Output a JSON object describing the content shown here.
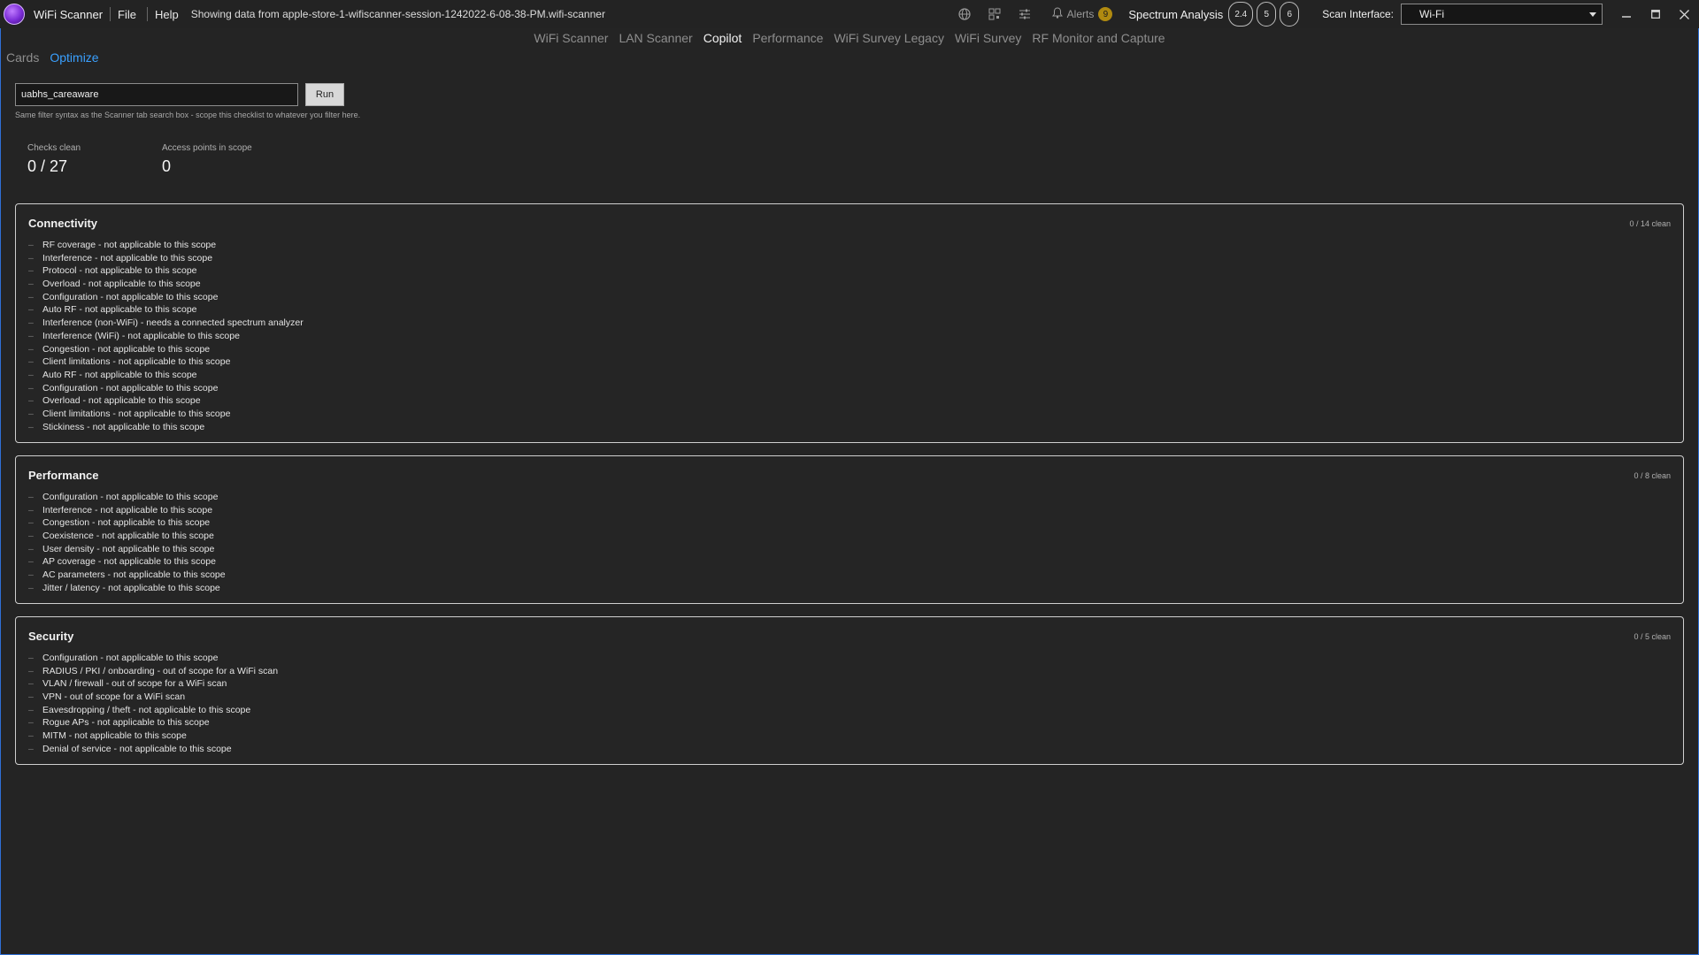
{
  "titlebar": {
    "app_name": "WiFi Scanner",
    "menu": [
      "File",
      "Help"
    ],
    "session": "Showing data from apple-store-1-wifiscanner-session-1242022-6-08-38-PM.wifi-scanner",
    "alerts_label": "Alerts",
    "alerts_count": "9",
    "spectrum_label": "Spectrum Analysis",
    "bands": [
      "2.4",
      "5",
      "6"
    ],
    "scan_interface_label": "Scan Interface:",
    "scan_interface_value": "Wi-Fi"
  },
  "nav": {
    "tabs": [
      "WiFi Scanner",
      "LAN Scanner",
      "Copilot",
      "Performance",
      "WiFi Survey Legacy",
      "WiFi Survey",
      "RF Monitor and Capture"
    ],
    "active": "Copilot"
  },
  "subtabs": {
    "items": [
      "Cards",
      "Optimize"
    ],
    "active": "Optimize"
  },
  "filter": {
    "value": "uabhs_careaware",
    "run_label": "Run",
    "hint": "Same filter syntax as the Scanner tab search box - scope this checklist to whatever you filter here."
  },
  "stats": {
    "checks_clean_label": "Checks clean",
    "checks_clean_value": "0 / 27",
    "aps_label": "Access points in scope",
    "aps_value": "0"
  },
  "sections": [
    {
      "title": "Connectivity",
      "count": "0 / 14 clean",
      "items": [
        "RF coverage - not applicable to this scope",
        "Interference - not applicable to this scope",
        "Protocol - not applicable to this scope",
        "Overload - not applicable to this scope",
        "Configuration - not applicable to this scope",
        "Auto RF - not applicable to this scope",
        "Interference (non-WiFi) - needs a connected spectrum analyzer",
        "Interference (WiFi) - not applicable to this scope",
        "Congestion - not applicable to this scope",
        "Client limitations - not applicable to this scope",
        "Auto RF - not applicable to this scope",
        "Configuration - not applicable to this scope",
        "Overload - not applicable to this scope",
        "Client limitations - not applicable to this scope",
        "Stickiness - not applicable to this scope"
      ]
    },
    {
      "title": "Performance",
      "count": "0 / 8 clean",
      "items": [
        "Configuration - not applicable to this scope",
        "Interference - not applicable to this scope",
        "Congestion - not applicable to this scope",
        "Coexistence - not applicable to this scope",
        "User density - not applicable to this scope",
        "AP coverage - not applicable to this scope",
        "AC parameters - not applicable to this scope",
        "Jitter / latency - not applicable to this scope"
      ]
    },
    {
      "title": "Security",
      "count": "0 / 5 clean",
      "items": [
        "Configuration - not applicable to this scope",
        "RADIUS / PKI / onboarding - out of scope for a WiFi scan",
        "VLAN / firewall - out of scope for a WiFi scan",
        "VPN - out of scope for a WiFi scan",
        "Eavesdropping / theft - not applicable to this scope",
        "Rogue APs - not applicable to this scope",
        "MITM - not applicable to this scope",
        "Denial of service - not applicable to this scope"
      ]
    }
  ],
  "icons": {
    "globe": "globe-icon",
    "grid": "qr-grid-icon",
    "sliders": "sliders-icon",
    "bell": "bell-icon"
  },
  "colors": {
    "accent": "#3aa0ff",
    "alert_badge": "#b08a10",
    "background": "#242424"
  }
}
